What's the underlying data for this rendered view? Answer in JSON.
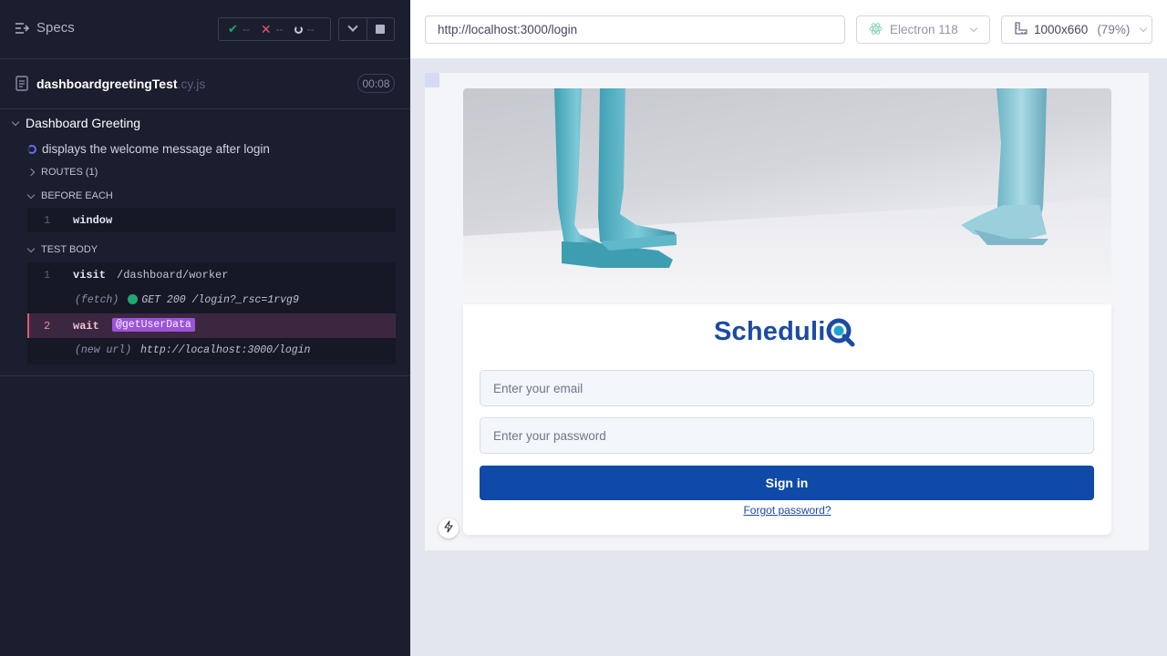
{
  "header": {
    "specs_label": "Specs",
    "passed": "--",
    "failed": "--",
    "pending": "--"
  },
  "spec": {
    "file_name": "dashboardgreetingTest",
    "file_ext": ".cy.js",
    "duration": "00:08"
  },
  "suite": {
    "title": "Dashboard Greeting",
    "test_title": "displays the welcome message after login",
    "routes_label": "ROUTES (1)",
    "before_each_label": "BEFORE EACH",
    "test_body_label": "TEST BODY",
    "before_each_commands": [
      {
        "num": "1",
        "name": "window",
        "arg": ""
      }
    ],
    "test_body_commands": [
      {
        "num": "1",
        "name": "visit",
        "arg": "/dashboard/worker"
      },
      {
        "num": "",
        "name": "(fetch)",
        "arg": "GET 200 /login?_rsc=1rvg9",
        "status_color": "#1fa971"
      },
      {
        "num": "2",
        "name": "wait",
        "arg": "@getUserData"
      },
      {
        "num": "",
        "name": "(new url)",
        "arg": "http://localhost:3000/login"
      }
    ]
  },
  "browser_bar": {
    "url": "http://localhost:3000/login",
    "browser": "Electron 118",
    "viewport": "1000x660",
    "zoom": "(79%)"
  },
  "app": {
    "logo_text": "ScheduliQ",
    "email_placeholder": "Enter your email",
    "password_placeholder": "Enter your password",
    "signin_label": "Sign in",
    "forgot_label": "Forgot password?",
    "brand_color": "#1c4ba3",
    "button_color": "#0f4aa8"
  },
  "icons": {
    "specs": "list-arrow-icon",
    "file": "document-icon",
    "browser": "electron-icon",
    "viewport": "ruler-icon",
    "bolt": "lightning-icon"
  }
}
